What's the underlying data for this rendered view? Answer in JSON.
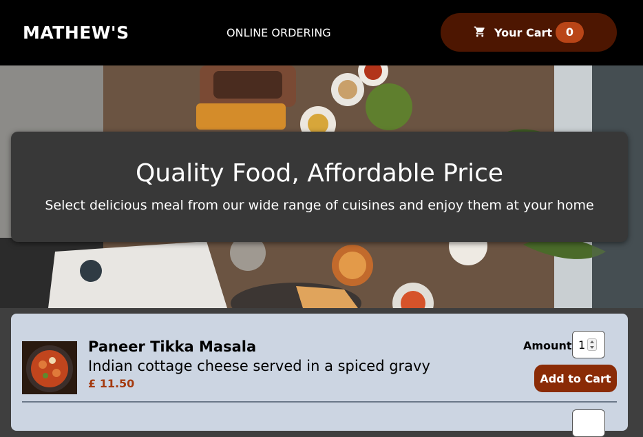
{
  "header": {
    "brand": "MATHEW'S",
    "nav_label": "ONLINE ORDERING",
    "cart_label": "Your Cart",
    "cart_count": "0",
    "cart_icon": "cart-icon"
  },
  "hero": {
    "title": "Quality Food, Affordable Price",
    "subtitle": "Select delicious meal from our wide range of cuisines and enjoy them at your home"
  },
  "meals": [
    {
      "name": "Paneer Tikka Masala",
      "description": "Indian cottage cheese served in a spiced gravy",
      "price": "£ 11.50",
      "amount_label": "Amount",
      "amount_value": "1",
      "add_label": "Add to Cart"
    }
  ],
  "colors": {
    "header_bg": "#000000",
    "cart_button": "#4d1601",
    "cart_badge": "#b94517",
    "hero_card": "#383838",
    "meals_bg": "#ccd5e2",
    "price": "#a43a0e",
    "add_button": "#8a2b06"
  }
}
